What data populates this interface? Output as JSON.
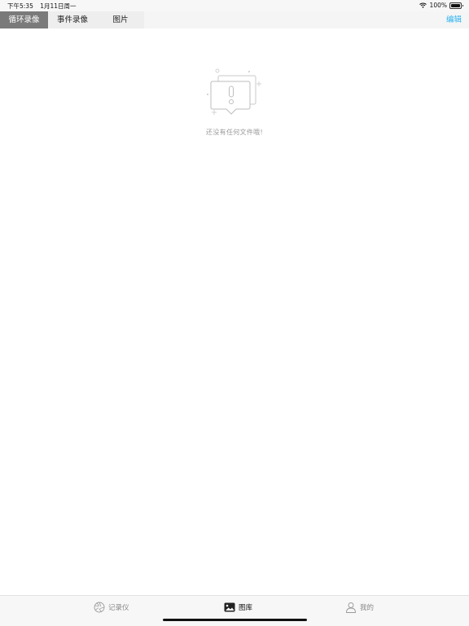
{
  "status_bar": {
    "time": "下午5:35",
    "date": "1月11日周一",
    "battery": "100%"
  },
  "tabs": [
    {
      "label": "循环录像",
      "active": true
    },
    {
      "label": "事件录像",
      "active": false
    },
    {
      "label": "图片",
      "active": false
    }
  ],
  "edit_label": "编辑",
  "empty_state": {
    "message": "还没有任何文件哦!",
    "icon": "empty-notice-icon"
  },
  "bottom_nav": [
    {
      "label": "记录仪",
      "icon": "aperture-icon",
      "active": false
    },
    {
      "label": "图库",
      "icon": "gallery-icon",
      "active": true
    },
    {
      "label": "我的",
      "icon": "user-icon",
      "active": false
    }
  ],
  "colors": {
    "accent": "#2bb3f0",
    "active_segment": "#7a7a7a",
    "muted_text": "#9a9a9a"
  }
}
